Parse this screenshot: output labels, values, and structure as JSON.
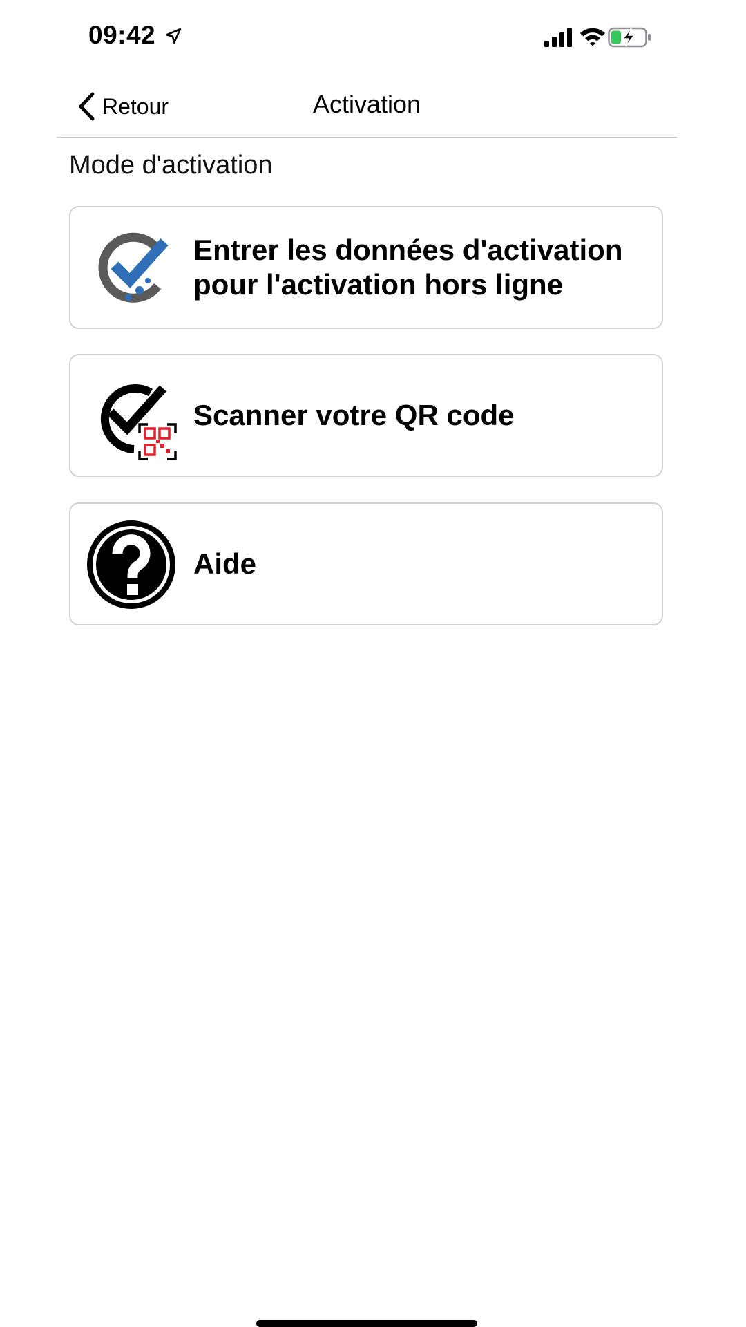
{
  "status_bar": {
    "time": "09:42",
    "icons": [
      "location-arrow-icon",
      "cellular-signal-icon",
      "wifi-icon",
      "battery-charging-icon"
    ],
    "battery_color": "#34c759"
  },
  "nav": {
    "back_label": "Retour",
    "back_icon": "chevron-left-icon",
    "title": "Activation"
  },
  "section": {
    "label": "Mode d'activation"
  },
  "options": [
    {
      "label": "Entrer les données d'activation pour l'activation hors ligne",
      "icon": "offline-activation-check-icon",
      "icon_colors": [
        "#5a5a5a",
        "#2f6fb7"
      ]
    },
    {
      "label": "Scanner votre QR code",
      "icon": "qr-code-check-icon",
      "icon_colors": [
        "#000000",
        "#e0202c"
      ]
    },
    {
      "label": "Aide",
      "icon": "help-question-icon",
      "icon_colors": [
        "#000000",
        "#ffffff"
      ]
    }
  ]
}
